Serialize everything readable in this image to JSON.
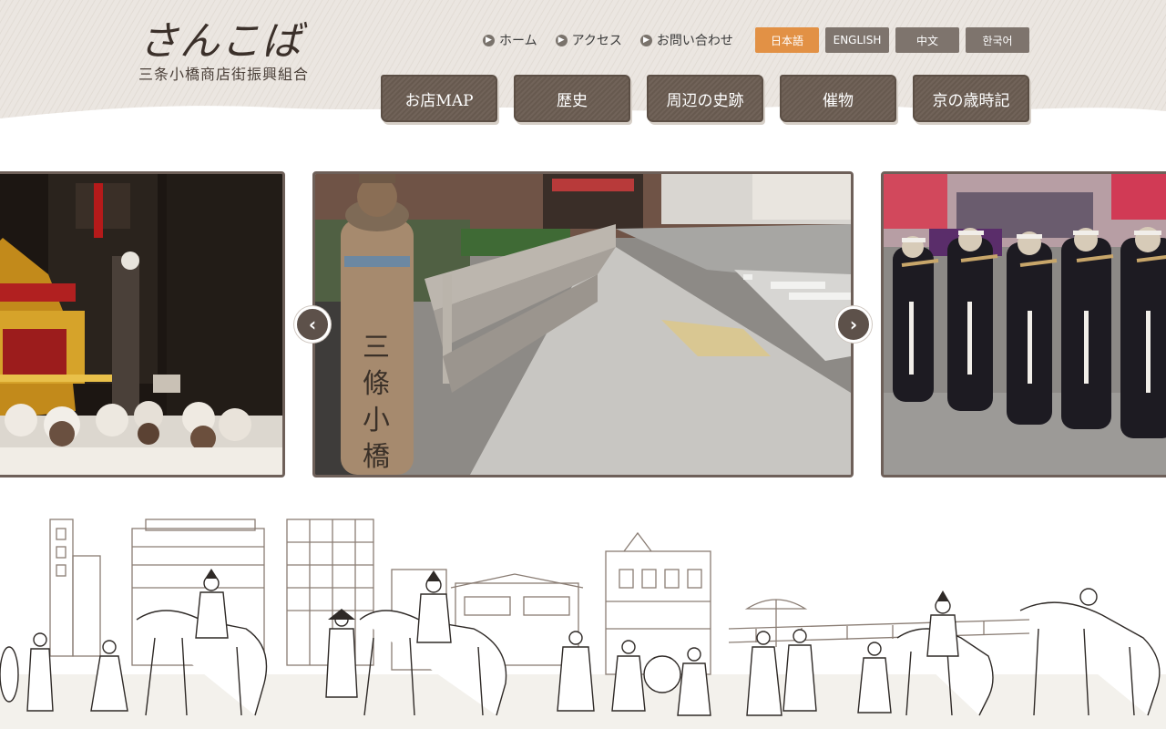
{
  "header": {
    "logo_title": "さんこば",
    "logo_subtitle": "三条小橋商店街振興組合"
  },
  "util_nav": [
    {
      "label": "ホーム",
      "icon": "arrow-right-icon"
    },
    {
      "label": "アクセス",
      "icon": "arrow-right-icon"
    },
    {
      "label": "お問い合わせ",
      "icon": "arrow-right-icon"
    }
  ],
  "lang_nav": [
    {
      "label": "日本語",
      "active": true
    },
    {
      "label": "ENGLISH",
      "active": false
    },
    {
      "label": "中文",
      "active": false
    },
    {
      "label": "한국어",
      "active": false
    }
  ],
  "main_nav": [
    {
      "label": "お店MAP"
    },
    {
      "label": "歴史"
    },
    {
      "label": "周辺の史跡"
    },
    {
      "label": "催物"
    },
    {
      "label": "京の歳時記"
    }
  ],
  "slider": {
    "prev_icon": "chevron-left-icon",
    "next_icon": "chevron-right-icon",
    "prev_glyph": "‹",
    "next_glyph": "›"
  },
  "colors": {
    "accent": "#e29145",
    "nav_brown": "#6b5d52",
    "lang_inactive": "#7e746d",
    "header_bg": "#ece7e2"
  }
}
